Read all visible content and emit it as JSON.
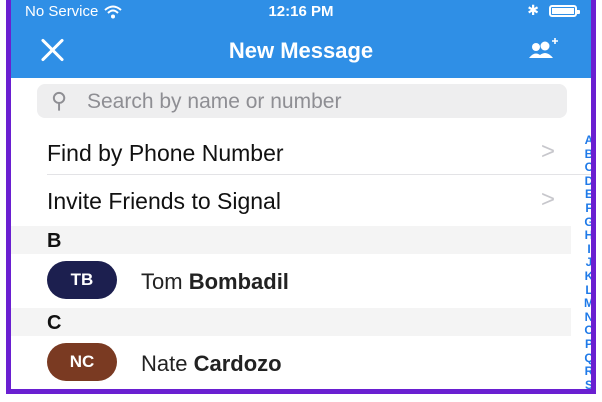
{
  "status_bar": {
    "carrier": "No Service",
    "time": "12:16 PM"
  },
  "header": {
    "title": "New Message"
  },
  "search": {
    "placeholder": "Search by name or number"
  },
  "actions": [
    {
      "label": "Find by Phone Number"
    },
    {
      "label": "Invite Friends to Signal"
    }
  ],
  "sections": [
    {
      "letter": "B",
      "contacts": [
        {
          "initials": "TB",
          "first": "Tom",
          "last": "Bombadil",
          "color": "#1c1f4f"
        }
      ]
    },
    {
      "letter": "C",
      "contacts": [
        {
          "initials": "NC",
          "first": "Nate",
          "last": "Cardozo",
          "color": "#7a3a22"
        }
      ]
    }
  ],
  "index_letters": [
    "A",
    "B",
    "C",
    "D",
    "E",
    "F",
    "G",
    "H",
    "I",
    "J",
    "K",
    "L",
    "M",
    "N",
    "O",
    "P",
    "Q",
    "R",
    "S"
  ],
  "colors": {
    "accent": "#2f8fe6",
    "index": "#1f7ae8"
  }
}
